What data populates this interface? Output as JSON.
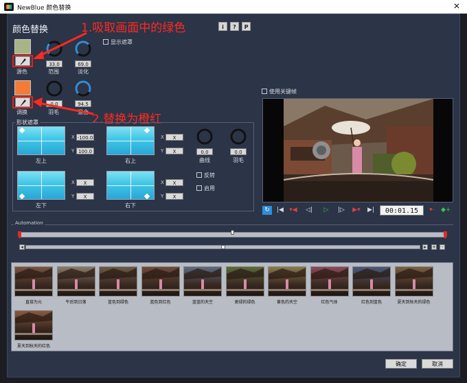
{
  "window": {
    "title": "NewBlue 颜色替换",
    "close_glyph": "✕"
  },
  "heading": "颜色替换",
  "help_buttons": [
    "i",
    "?",
    "P"
  ],
  "annotations": {
    "step1": "1.吸取画面中的绿色",
    "step2": "2.替换为橙红"
  },
  "source": {
    "swatch_color": "#a8b486",
    "label": "源色",
    "range_label": "范围",
    "range_value": "33.0",
    "range_level": 0.33,
    "fade_label": "淡化",
    "fade_value": "69.0",
    "fade_level": 0.69
  },
  "replace": {
    "swatch_color": "#f37a37",
    "label": "调换",
    "feather_label": "羽毛",
    "feather_value": "0.0",
    "feather_level": 0,
    "mix_label": "混合",
    "mix_value": "94.5",
    "mix_level": 0.945
  },
  "show_mask_label": "显示遮罩",
  "use_keyframes_label": "使用关键帧",
  "shape_mask": {
    "legend": "形状遮罩",
    "top_left": {
      "label": "左上",
      "x": "-100.0",
      "y": "100.0"
    },
    "top_right": {
      "label": "右上",
      "x": "X",
      "y": "X"
    },
    "bottom_left": {
      "label": "左下",
      "x": "X",
      "y": "X"
    },
    "bottom_right": {
      "label": "右下",
      "x": "X",
      "y": "X"
    },
    "curve_label": "曲线",
    "curve_value": "0.0",
    "feather_label": "羽毛",
    "feather_value": "0.0",
    "invert_label": "反转",
    "enable_label": "启用",
    "x_axis": "X",
    "y_axis": "Y"
  },
  "transport": {
    "timecode": "00:01.15"
  },
  "automation": {
    "legend": "Automation"
  },
  "presets": [
    "直接为元",
    "午后到日落",
    "蓝色到绿色",
    "蓝色到红色",
    "蓝蓝的天空",
    "更绿的绿色",
    "黄色的天空",
    "红色气体",
    "红色到蓝色",
    "夏天到秋天的绿色",
    "夏天到秋天的红色"
  ],
  "buttons": {
    "ok": "确定",
    "cancel": "取消"
  },
  "colors": {
    "panel": "#2c3447",
    "accent_red": "#ff2a1f",
    "knob_blue": "#2f8fd8"
  }
}
